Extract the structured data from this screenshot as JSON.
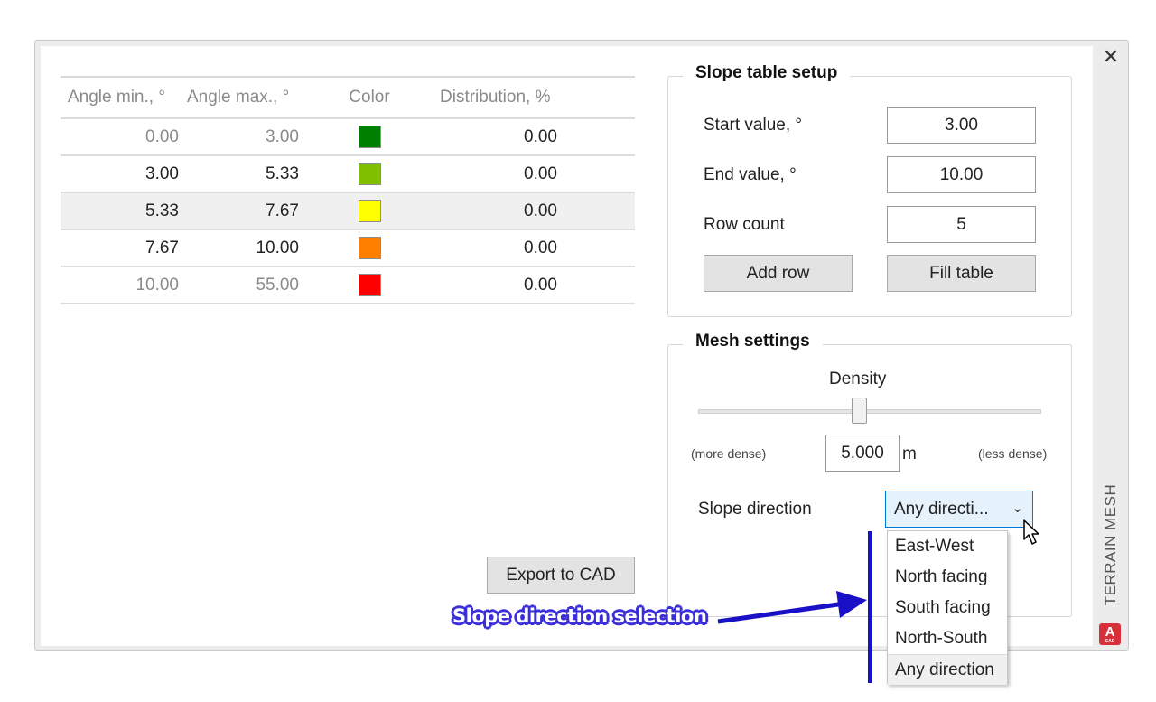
{
  "window": {
    "title": "TERRAIN MESH",
    "close_glyph": "✕",
    "logo_letter": "A",
    "logo_sub": "CAD"
  },
  "table": {
    "headers": [
      "Angle min., °",
      "Angle max., °",
      "Color",
      "Distribution, %"
    ],
    "rows": [
      {
        "min": "0.00",
        "max": "3.00",
        "color": "#008000",
        "dist": "0.00"
      },
      {
        "min": "3.00",
        "max": "5.33",
        "color": "#7fbf00",
        "dist": "0.00"
      },
      {
        "min": "5.33",
        "max": "7.67",
        "color": "#ffff00",
        "dist": "0.00"
      },
      {
        "min": "7.67",
        "max": "10.00",
        "color": "#ff8000",
        "dist": "0.00"
      },
      {
        "min": "10.00",
        "max": "55.00",
        "color": "#ff0000",
        "dist": "0.00"
      }
    ],
    "selected_row": 2
  },
  "export_label": "Export to CAD",
  "slope_setup": {
    "title": "Slope table setup",
    "start_label": "Start value, °",
    "start_value": "3.00",
    "end_label": "End value, °",
    "end_value": "10.00",
    "count_label": "Row count",
    "count_value": "5",
    "add_row": "Add row",
    "fill_table": "Fill table"
  },
  "mesh": {
    "title": "Mesh settings",
    "density_label": "Density",
    "density_level": 0.47,
    "more_dense": "(more dense)",
    "less_dense": "(less dense)",
    "density_value": "5.000",
    "unit": "m",
    "direction_label": "Slope direction",
    "direction_selected": "Any directi...",
    "options": [
      "East-West",
      "North facing",
      "South facing",
      "North-South",
      "Any direction"
    ],
    "highlighted_option": 4
  },
  "annotation": {
    "text": "Slope direction selection",
    "color": "#1a10c8"
  }
}
